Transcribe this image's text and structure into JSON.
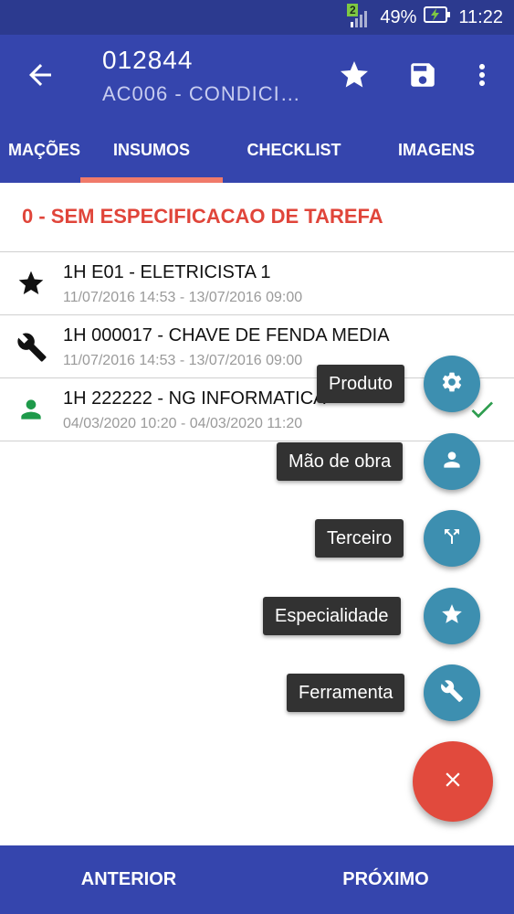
{
  "status_bar": {
    "sim_badge": "2",
    "battery": "49%",
    "time": "11:22"
  },
  "app_bar": {
    "title": "012844",
    "subtitle": "AC006 - CONDICI…",
    "icons": [
      "back-arrow-icon",
      "star-icon",
      "save-icon",
      "more-vert-icon"
    ]
  },
  "tabs": [
    {
      "label": "MAÇÕES",
      "selected": false
    },
    {
      "label": "INSUMOS",
      "selected": true
    },
    {
      "label": "CHECKLIST",
      "selected": false
    },
    {
      "label": "IMAGENS",
      "selected": false
    }
  ],
  "section_title": "0 - SEM ESPECIFICACAO DE TAREFA",
  "items": [
    {
      "icon": "star-icon",
      "title": "1H E01 - ELETRICISTA 1",
      "dates": "11/07/2016 14:53 - 13/07/2016 09:00"
    },
    {
      "icon": "wrench-icon",
      "title": "1H 000017 - CHAVE DE FENDA MEDIA",
      "dates": "11/07/2016 14:53 - 13/07/2016 09:00"
    },
    {
      "icon": "person-icon",
      "title": "1H 222222 - NG INFORMATICA",
      "dates": "04/03/2020 10:20 - 04/03/2020 11:20",
      "checked": true
    }
  ],
  "fab_menu": [
    {
      "label": "Produto",
      "icon": "gear-icon"
    },
    {
      "label": "Mão de obra",
      "icon": "person-icon"
    },
    {
      "label": "Terceiro",
      "icon": "merge-icon"
    },
    {
      "label": "Especialidade",
      "icon": "star-icon"
    },
    {
      "label": "Ferramenta",
      "icon": "wrench-icon"
    }
  ],
  "fab_main_icon": "close-icon",
  "bottom_nav": {
    "previous": "ANTERIOR",
    "next": "PRÓXIMO"
  },
  "colors": {
    "primary": "#3545ad",
    "status_bar": "#2c3a8f",
    "accent": "#e0453a",
    "tab_indicator": "#f07a6a",
    "mini_fab": "#3d8fb0",
    "main_fab": "#e14a3d",
    "person_icon": "#1e9a4a",
    "check": "#2e9d4f"
  }
}
